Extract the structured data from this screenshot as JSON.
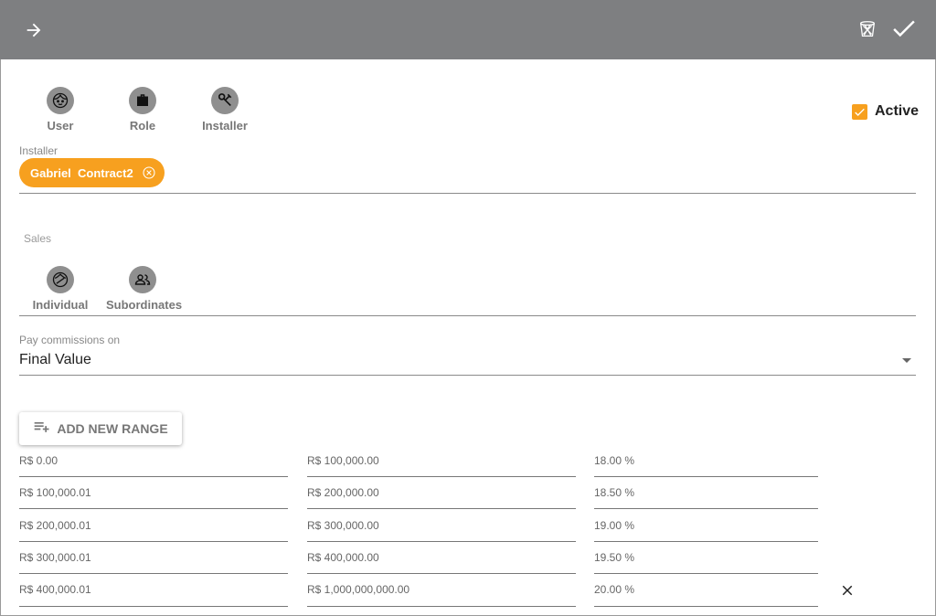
{
  "colors": {
    "topbar": "#7e7f81",
    "accent": "#f7a01f",
    "icon_grey": "#8f8f8f"
  },
  "toolbar": {
    "back_icon": "arrow-right-icon",
    "delete_icon": "trash-icon",
    "save_icon": "check-icon"
  },
  "types": [
    {
      "label": "User",
      "icon": "face-icon"
    },
    {
      "label": "Role",
      "icon": "briefcase-icon"
    },
    {
      "label": "Installer",
      "icon": "tools-icon"
    }
  ],
  "active": {
    "label": "Active",
    "checked": true
  },
  "installer": {
    "label": "Installer",
    "chip": "Gabriel  Contract2"
  },
  "sales": {
    "label": "Sales",
    "options": [
      {
        "label": "Individual",
        "icon": "individual-icon"
      },
      {
        "label": "Subordinates",
        "icon": "people-icon"
      }
    ]
  },
  "pay_commissions": {
    "label": "Pay commissions on",
    "value": "Final Value"
  },
  "add_range": {
    "label": "ADD NEW RANGE"
  },
  "ranges": [
    {
      "from": "R$ 0.00",
      "to": "R$ 100,000.00",
      "percent": "18.00 %"
    },
    {
      "from": "R$ 100,000.01",
      "to": "R$ 200,000.00",
      "percent": "18.50 %"
    },
    {
      "from": "R$ 200,000.01",
      "to": "R$ 300,000.00",
      "percent": "19.00 %"
    },
    {
      "from": "R$ 300,000.01",
      "to": "R$ 400,000.00",
      "percent": "19.50 %"
    },
    {
      "from": "R$ 400,000.01",
      "to": "R$ 1,000,000,000.00",
      "percent": "20.00 %"
    }
  ]
}
